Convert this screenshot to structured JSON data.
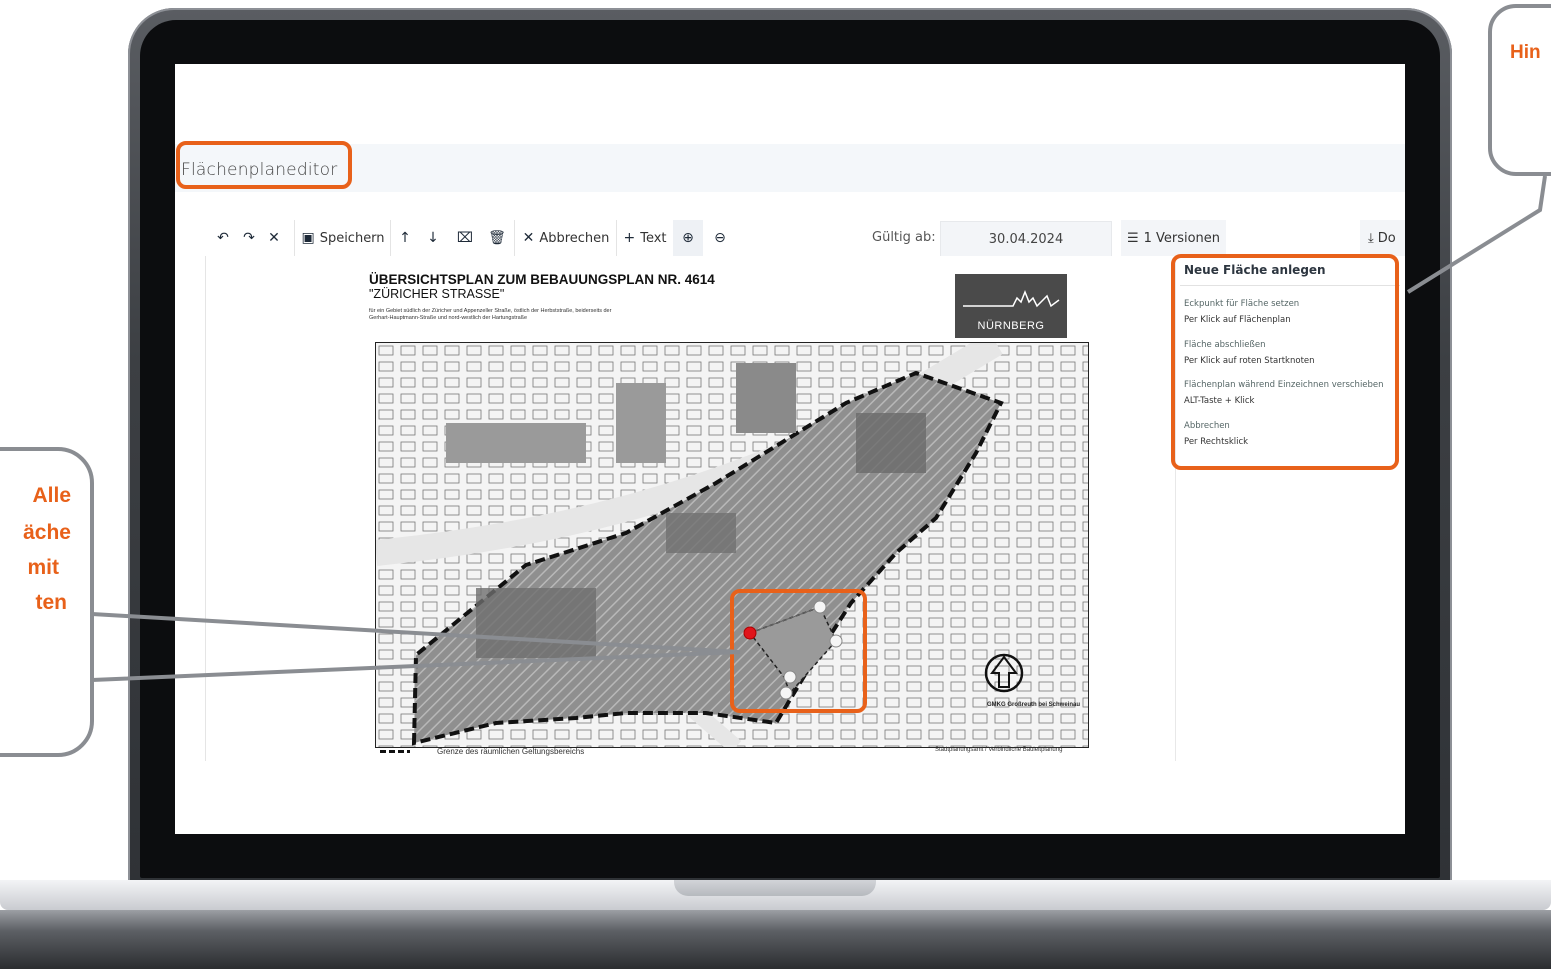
{
  "app": {
    "title": "Flächenplaneditor"
  },
  "toolbar": {
    "undo_icon": "undo-icon",
    "redo_icon": "redo-icon",
    "close_icon": "close-icon",
    "save_label": "Speichern",
    "cancel_label": "Abbrechen",
    "text_label": "Text",
    "valid_from_label": "Gültig ab:",
    "valid_from_value": "30.04.2024",
    "versions_label": "1 Versionen",
    "download_label": "Do"
  },
  "side_panel": {
    "title": "Neue Fläche anlegen",
    "hints": [
      {
        "title": "Eckpunkt für Fläche setzen",
        "detail": "Per Klick auf Flächenplan"
      },
      {
        "title": "Fläche abschließen",
        "detail": "Per Klick auf roten Startknoten"
      },
      {
        "title": "Flächenplan während Einzeichnen verschieben",
        "detail": "ALT-Taste + Klick"
      },
      {
        "title": "Abbrechen",
        "detail": "Per Rechtsklick"
      }
    ]
  },
  "plan": {
    "title": "ÜBERSICHTSPLAN ZUM BEBAUUNGSPLAN NR. 4614",
    "subtitle": "\"ZÜRICHER STRASSE\"",
    "description": "für ein Gebiet südlich der Züricher und Appenzeller Straße, östlich der Herbststraße, beiderseits der Gerhart-Hauptmann-Straße und nord-westlich der Hartungstraße",
    "logo_text": "NÜRNBERG",
    "legend": "Grenze des räumlichen Geltungsbereichs",
    "footer": "Stadtplanungsamt / Verbindliche Bauleitplanung",
    "gmk": "GMKG Großreuth bei Schweinau"
  },
  "callouts": {
    "right_text": "Hin",
    "left_lines": [
      "Alle",
      "äche",
      "mit",
      "ten"
    ]
  },
  "colors": {
    "accent": "#e8611a",
    "callout_border": "#8a8d92",
    "red_node": "#e0141b"
  }
}
